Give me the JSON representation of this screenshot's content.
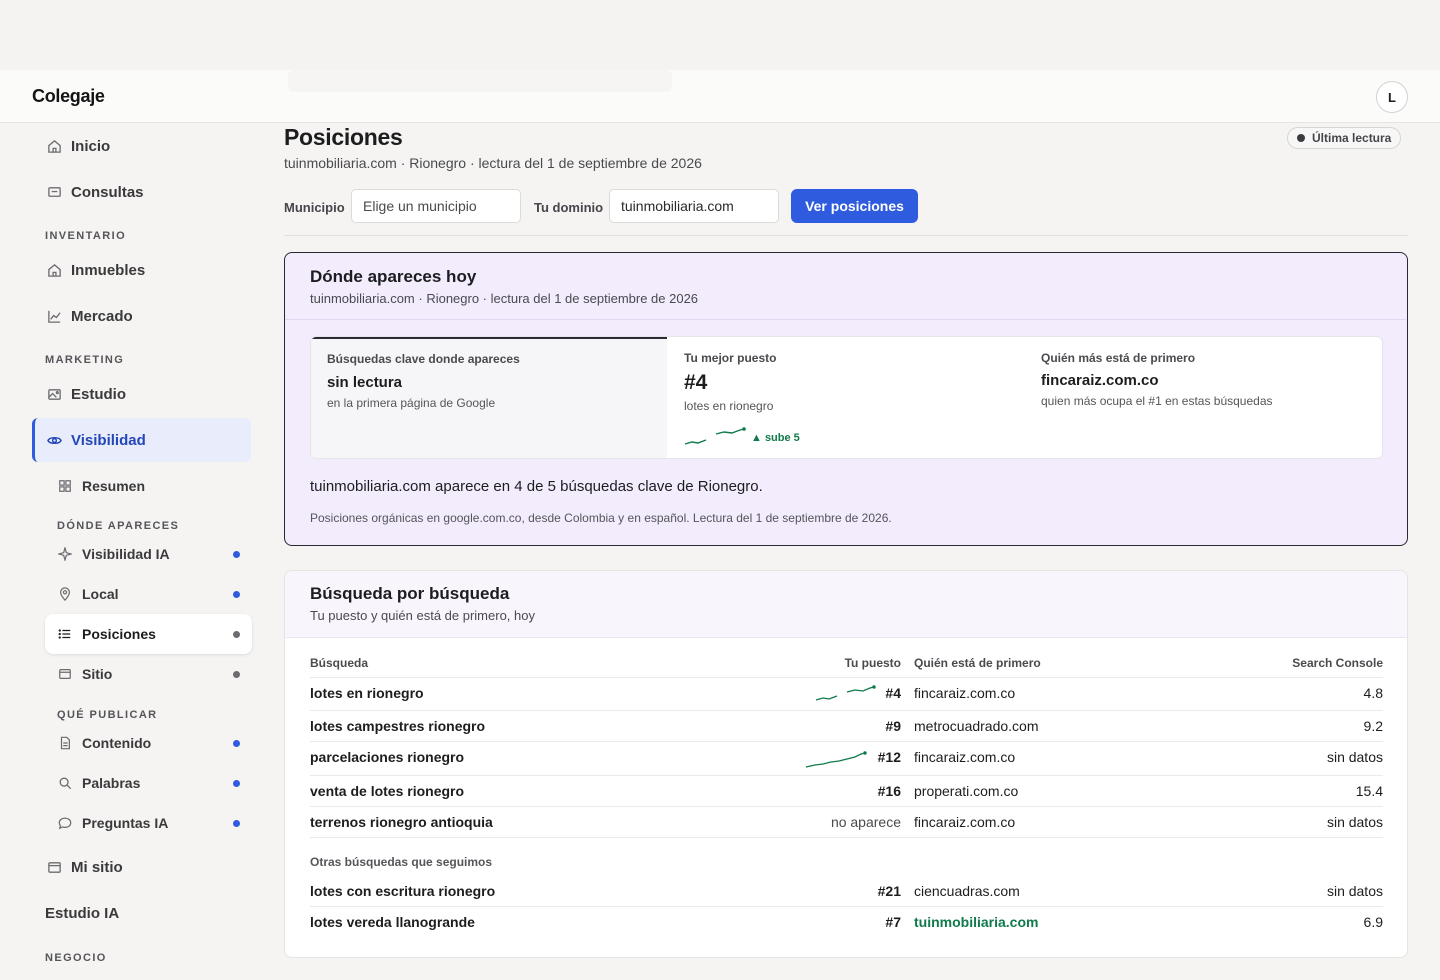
{
  "app": {
    "brand": "Colegaje",
    "avatar_initial": "L"
  },
  "sidebar": {
    "inicio": "Inicio",
    "consultas": "Consultas",
    "section_inventario": "INVENTARIO",
    "inmuebles": "Inmuebles",
    "mercado": "Mercado",
    "section_marketing": "MARKETING",
    "estudio": "Estudio",
    "visibilidad": "Visibilidad",
    "resumen": "Resumen",
    "section_donde": "DÓNDE APARECES",
    "visibilidad_ia": "Visibilidad IA",
    "local": "Local",
    "posiciones": "Posiciones",
    "sitio": "Sitio",
    "section_que": "QUÉ PUBLICAR",
    "contenido": "Contenido",
    "palabras": "Palabras",
    "preguntas_ia": "Preguntas IA",
    "mi_sitio": "Mi sitio",
    "estudio_ia": "Estudio IA",
    "section_negocio": "NEGOCIO"
  },
  "page": {
    "title": "Posiciones",
    "subtitle": "tuinmobiliaria.com · Rionegro · lectura del 1 de septiembre de 2026",
    "badge": "Última lectura"
  },
  "filters": {
    "municipio_label": "Municipio",
    "municipio_placeholder": "Elige un municipio",
    "dominio_label": "Tu dominio",
    "dominio_value": "tuinmobiliaria.com",
    "submit": "Ver posiciones"
  },
  "today": {
    "title": "Dónde apareces hoy",
    "subtitle": "tuinmobiliaria.com · Rionegro · lectura del 1 de septiembre de 2026",
    "stat1_label": "Búsquedas clave donde apareces",
    "stat1_value": "sin lectura",
    "stat1_note": "en la primera página de Google",
    "stat2_label": "Tu mejor puesto",
    "stat2_value": "#4",
    "stat2_note": "lotes en rionegro",
    "stat2_trend": "▲ sube 5",
    "stat3_label": "Quién más está de primero",
    "stat3_value": "fincaraiz.com.co",
    "stat3_note": "quien más ocupa el #1 en estas búsquedas",
    "summary": "tuinmobiliaria.com aparece en 4 de 5 búsquedas clave de Rionegro.",
    "footnote": "Posiciones orgánicas en google.com.co, desde Colombia y en español. Lectura del 1 de septiembre de 2026."
  },
  "table": {
    "title": "Búsqueda por búsqueda",
    "subtitle": "Tu puesto y quién está de primero, hoy",
    "col_busqueda": "Búsqueda",
    "col_puesto": "Tu puesto",
    "col_primero": "Quién está de primero",
    "col_console": "Search Console",
    "rows": [
      {
        "query": "lotes en rionegro",
        "rank": "#4",
        "leader": "fincaraiz.com.co",
        "console": "4.8"
      },
      {
        "query": "lotes campestres rionegro",
        "rank": "#9",
        "leader": "metrocuadrado.com",
        "console": "9.2"
      },
      {
        "query": "parcelaciones rionegro",
        "rank": "#12",
        "leader": "fincaraiz.com.co",
        "console": "sin datos"
      },
      {
        "query": "venta de lotes rionegro",
        "rank": "#16",
        "leader": "properati.com.co",
        "console": "15.4"
      },
      {
        "query": "terrenos rionegro antioquia",
        "rank": "no aparece",
        "leader": "fincaraiz.com.co",
        "console": "sin datos"
      }
    ],
    "other_label": "Otras búsquedas que seguimos",
    "other_rows": [
      {
        "query": "lotes con escritura rionegro",
        "rank": "#21",
        "leader": "ciencuadras.com",
        "console": "sin datos"
      },
      {
        "query": "lotes vereda llanogrande",
        "rank": "#7",
        "leader": "tuinmobiliaria.com",
        "console": "6.9"
      }
    ]
  },
  "colors": {
    "accent": "#2f5bde",
    "positive": "#0f7a4a",
    "card_tint": "#f2ecfd",
    "dot_blue": "#2f5bde",
    "dot_gray": "#6b6b70"
  },
  "icons": [
    "home-icon",
    "message-icon",
    "home-icon",
    "chart-icon",
    "image-icon",
    "eye-icon",
    "grid-icon",
    "sparkle-icon",
    "pin-icon",
    "list-icon",
    "window-icon",
    "document-icon",
    "search-icon",
    "chat-icon",
    "window-icon"
  ]
}
